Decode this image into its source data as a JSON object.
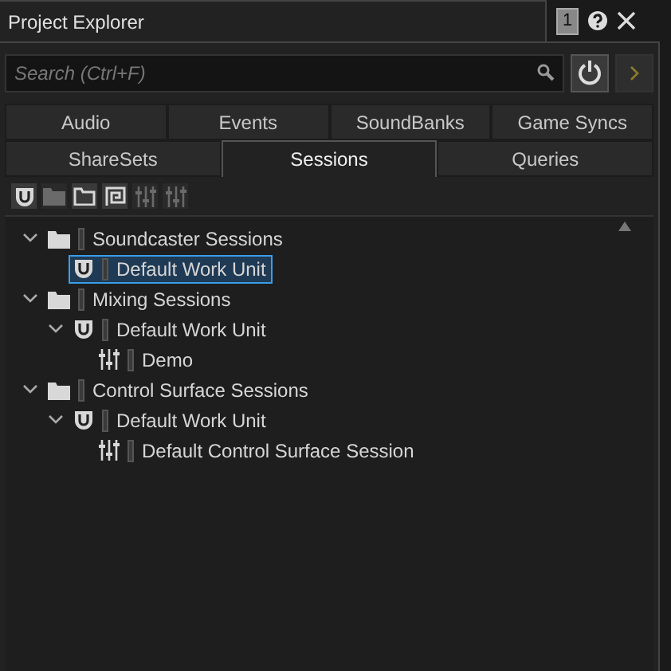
{
  "window": {
    "title": "Project Explorer",
    "badge": "1"
  },
  "search": {
    "placeholder": "Search (Ctrl+F)"
  },
  "toolbar": [
    {
      "kind": "workunit",
      "disabled": false
    },
    {
      "kind": "folder",
      "disabled": true
    },
    {
      "kind": "folder-outline",
      "disabled": false
    },
    {
      "kind": "spiral",
      "disabled": false
    },
    {
      "kind": "mixer",
      "disabled": true
    },
    {
      "kind": "mixer",
      "disabled": true
    }
  ],
  "tabs": [
    [
      {
        "label": "Audio",
        "selected": false
      },
      {
        "label": "Events",
        "selected": false
      },
      {
        "label": "SoundBanks",
        "selected": false
      },
      {
        "label": "Game Syncs",
        "selected": false
      }
    ],
    [
      {
        "label": "ShareSets",
        "selected": false
      },
      {
        "label": "Sessions",
        "selected": true
      },
      {
        "label": "Queries",
        "selected": false
      }
    ]
  ],
  "tree": [
    {
      "label": "Soundcaster Sessions",
      "kind": "folder",
      "expanded": true,
      "selected": false,
      "children": [
        {
          "label": "Default Work Unit",
          "kind": "workunit",
          "selected": true
        }
      ]
    },
    {
      "label": "Mixing Sessions",
      "kind": "folder",
      "expanded": true,
      "selected": false,
      "children": [
        {
          "label": "Default Work Unit",
          "kind": "workunit",
          "expanded": true,
          "selected": false,
          "children": [
            {
              "label": "Demo",
              "kind": "session",
              "selected": false
            }
          ]
        }
      ]
    },
    {
      "label": "Control Surface Sessions",
      "kind": "folder",
      "expanded": true,
      "selected": false,
      "children": [
        {
          "label": "Default Work Unit",
          "kind": "workunit",
          "expanded": true,
          "selected": false,
          "children": [
            {
              "label": "Default Control Surface Session",
              "kind": "session",
              "selected": false
            }
          ]
        }
      ]
    }
  ]
}
